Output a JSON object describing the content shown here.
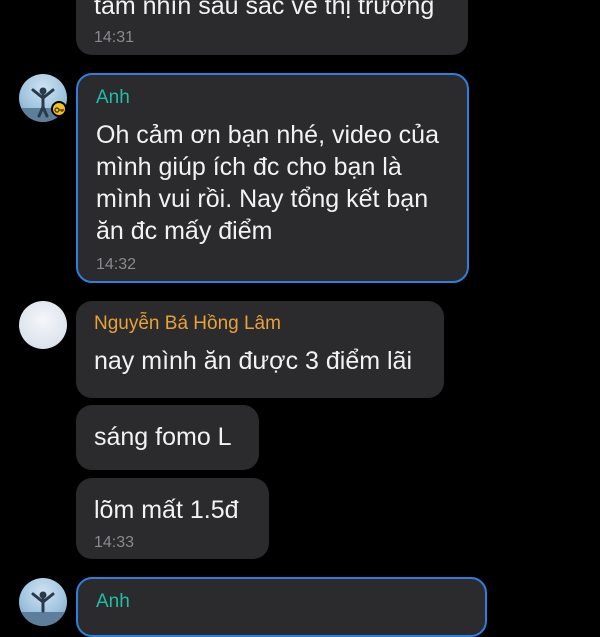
{
  "theme": {
    "background": "#000000",
    "bubble": "#2b2b2d",
    "highlight_border": "#2f7fdc",
    "anh_name_color": "#1dbfa8",
    "lam_name_color": "#e8a23a",
    "timestamp_color": "#8a8a8e"
  },
  "messages": [
    {
      "text": "tầm nhìn sâu sắc về thị trường",
      "time": "14:31"
    },
    {
      "sender": "Anh",
      "lines": [
        "Oh cảm ơn bạn nhé, video của",
        "mình giúp ích đc cho bạn là",
        "mình vui rồi. Nay tổng kết bạn",
        "ăn đc mấy điểm"
      ],
      "time": "14:32"
    },
    {
      "sender": "Nguyễn Bá Hồng Lâm",
      "text": "nay mình ăn được 3 điểm lãi"
    },
    {
      "text": "sáng fomo L"
    },
    {
      "text": "lõm mất 1.5đ",
      "time": "14:33"
    },
    {
      "sender": "Anh"
    }
  ],
  "icons": {
    "key_badge": "key-icon",
    "person": "person-silhouette-icon"
  }
}
